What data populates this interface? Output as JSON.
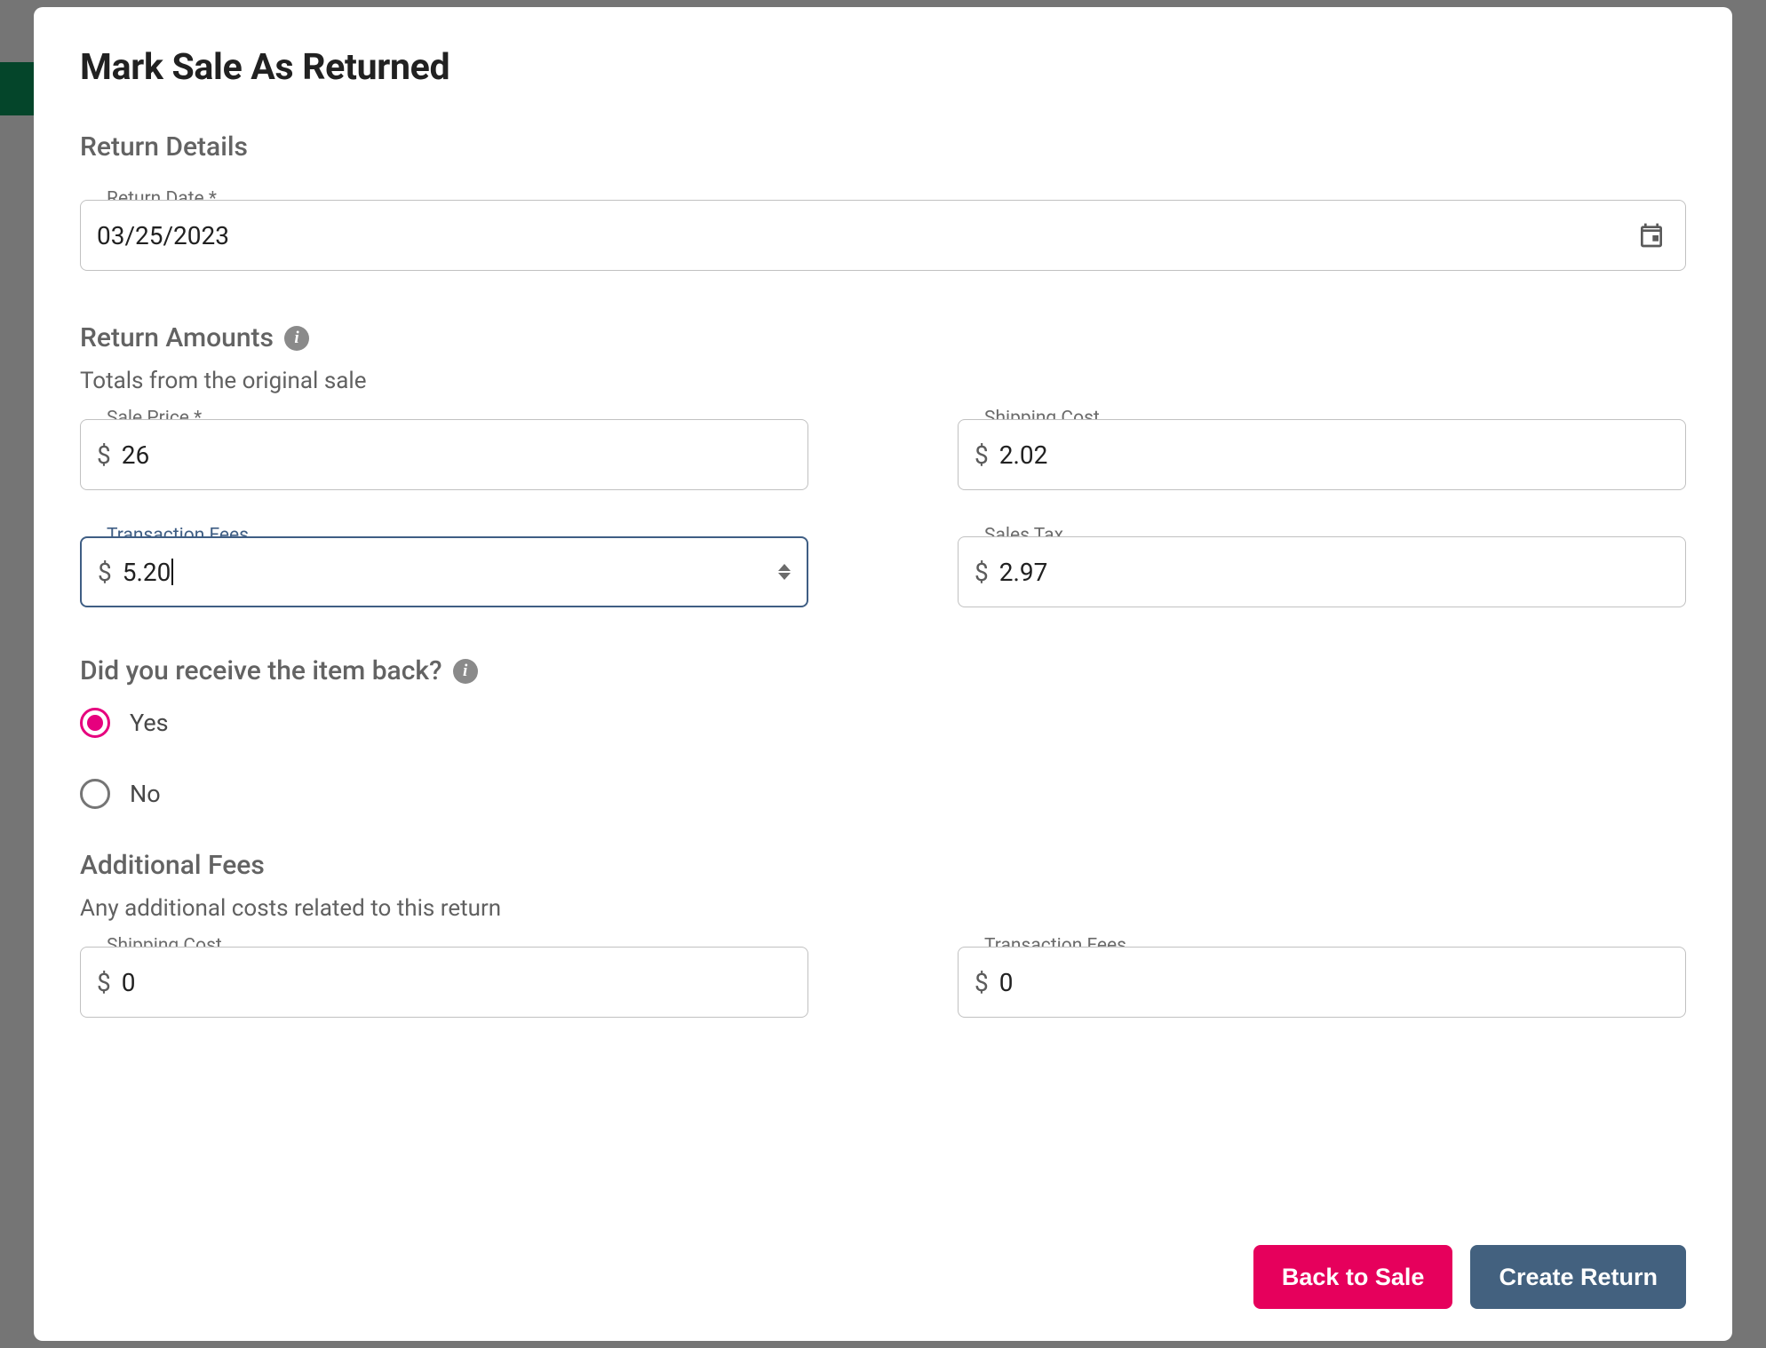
{
  "modal": {
    "title": "Mark Sale As Returned"
  },
  "returnDetails": {
    "header": "Return Details",
    "returnDate": {
      "label": "Return Date *",
      "value": "03/25/2023"
    }
  },
  "returnAmounts": {
    "header": "Return Amounts",
    "subtitle": "Totals from the original sale",
    "salePrice": {
      "label": "Sale Price *",
      "value": "26"
    },
    "shippingCost": {
      "label": "Shipping Cost",
      "value": "2.02"
    },
    "transactionFees": {
      "label": "Transaction Fees",
      "value": "5.20"
    },
    "salesTax": {
      "label": "Sales Tax",
      "value": "2.97"
    }
  },
  "receiveBack": {
    "header": "Did you receive the item back?",
    "yes": "Yes",
    "no": "No",
    "selected": "yes"
  },
  "additionalFees": {
    "header": "Additional Fees",
    "subtitle": "Any additional costs related to this return",
    "shippingCost": {
      "label": "Shipping Cost",
      "value": "0"
    },
    "transactionFees": {
      "label": "Transaction Fees",
      "value": "0"
    }
  },
  "footer": {
    "back": "Back to Sale",
    "create": "Create Return"
  }
}
